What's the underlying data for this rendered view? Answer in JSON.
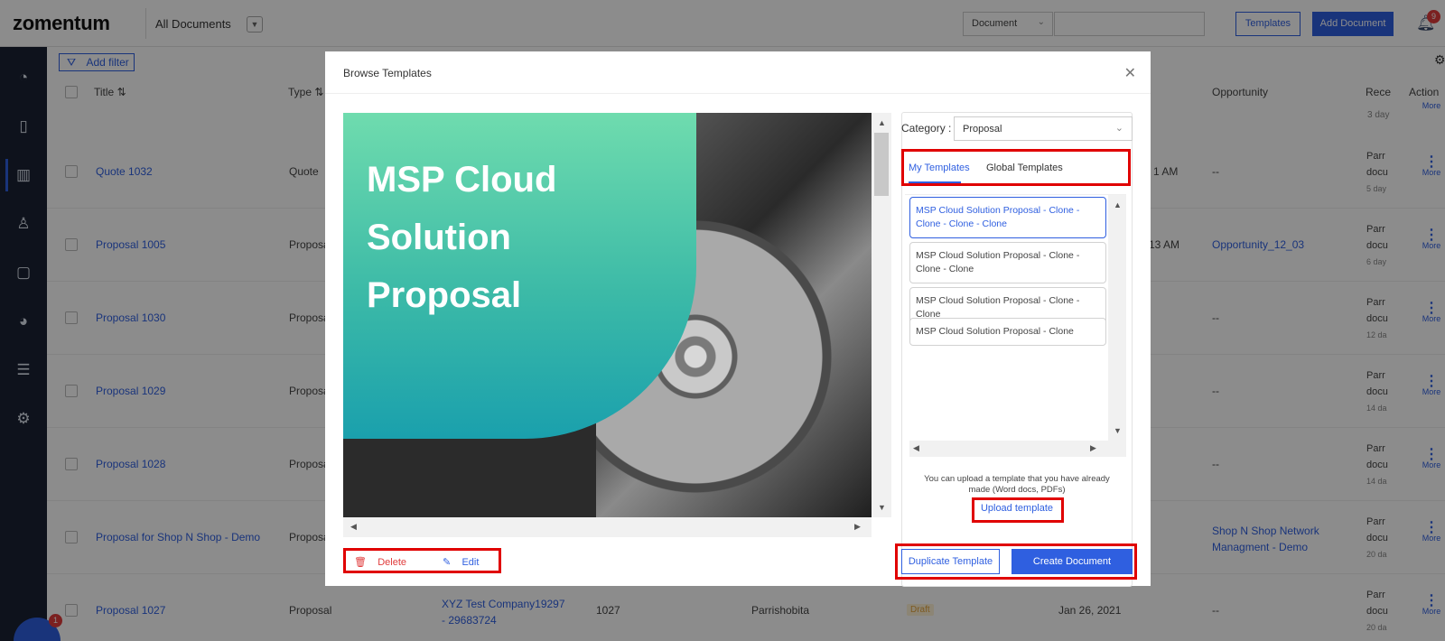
{
  "header": {
    "logo": "zomentum",
    "view_name": "All Documents",
    "search_type": "Document",
    "templates_button": "Templates",
    "add_document_button": "Add Document",
    "notification_count": "9"
  },
  "toolbar": {
    "add_filter": "Add filter"
  },
  "table": {
    "columns": [
      "Title",
      "Type",
      "Opportunity",
      "Rece",
      "Action"
    ],
    "rows": [
      {
        "title": "Quote 1032",
        "type": "Quote",
        "opportunity": "--",
        "col_partial": "1 AM",
        "rece_line1": "Parr",
        "rece_line2": "docu",
        "rece_line3": "5 day"
      },
      {
        "title": "Proposal 1005",
        "type": "Proposa",
        "opportunity": "Opportunity_12_03",
        "col_partial": "13 AM",
        "rece_line1": "Parr",
        "rece_line2": "docu",
        "rece_line3": "6 day"
      },
      {
        "title": "Proposal 1030",
        "type": "Proposa",
        "opportunity": "--",
        "col_partial": "",
        "rece_line1": "Parr",
        "rece_line2": "docu",
        "rece_line3": "12 da"
      },
      {
        "title": "Proposal 1029",
        "type": "Proposa",
        "opportunity": "--",
        "col_partial": "",
        "rece_line1": "Parr",
        "rece_line2": "docu",
        "rece_line3": "14 da"
      },
      {
        "title": "Proposal 1028",
        "type": "Proposa",
        "opportunity": "--",
        "col_partial": "",
        "rece_line1": "Parr",
        "rece_line2": "docu",
        "rece_line3": "14 da"
      },
      {
        "title": "Proposal for Shop N Shop - Demo",
        "type": "Proposa",
        "opportunity": "Shop N Shop Network Managment - Demo",
        "col_partial": "",
        "rece_line1": "Parr",
        "rece_line2": "docu",
        "rece_line3": "20 da"
      },
      {
        "title": "Proposal 1027",
        "type": "Proposal",
        "opportunity": "--",
        "col_partial": "",
        "rece_line1": "Parr",
        "rece_line2": "docu",
        "rece_line3": "20 da"
      }
    ],
    "first_row_partial": "3 day",
    "last_row_client": "XYZ Test Company19297 - 29683724",
    "last_row_number": "1027",
    "last_row_owner": "Parrishobita",
    "last_row_status": "Draft",
    "last_row_date": "Jan 26, 2021",
    "more_label": "More"
  },
  "chat": {
    "badge": "1"
  },
  "modal": {
    "title": "Browse Templates",
    "close_icon": "close-icon",
    "preview_title": "MSP Cloud Solution Proposal",
    "category_label": "Category :",
    "category_value": "Proposal",
    "tabs": [
      "My Templates",
      "Global Templates"
    ],
    "templates": [
      "MSP Cloud Solution Proposal - Clone - Clone - Clone - Clone",
      "MSP Cloud Solution Proposal - Clone - Clone - Clone",
      "MSP Cloud Solution Proposal - Clone - Clone",
      "MSP Cloud Solution Proposal - Clone"
    ],
    "upload_hint": "You can upload a template that you have already made (Word docs, PDFs)",
    "upload_link": "Upload template",
    "delete_label": "Delete",
    "edit_label": "Edit",
    "duplicate_button": "Duplicate Template",
    "create_button": "Create Document"
  },
  "colors": {
    "accent": "#2f5fe0",
    "highlight_box": "#e00000",
    "sidebar": "#1a2233"
  }
}
